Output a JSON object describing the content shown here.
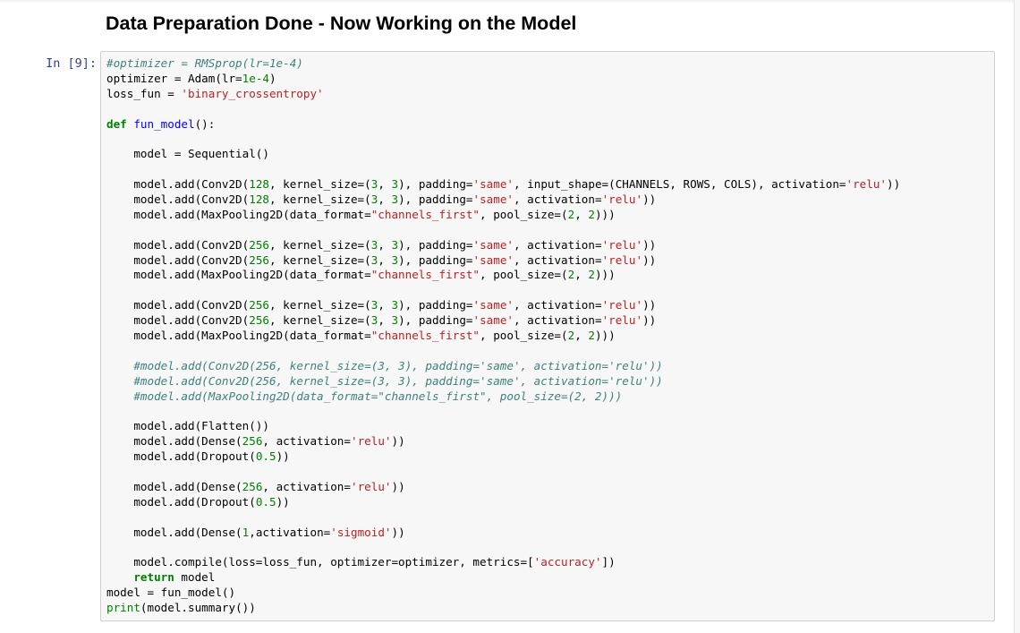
{
  "heading": "Data Preparation Done - Now Working on the Model",
  "cell": {
    "prompt": "In [9]:",
    "lines": [
      [
        {
          "t": "cm",
          "v": "#optimizer = RMSprop(lr=1e-4)"
        }
      ],
      [
        {
          "t": "tx",
          "v": "optimizer = Adam(lr="
        },
        {
          "t": "nm",
          "v": "1e-4"
        },
        {
          "t": "tx",
          "v": ")"
        }
      ],
      [
        {
          "t": "tx",
          "v": "loss_fun = "
        },
        {
          "t": "st",
          "v": "'binary_crossentropy'"
        }
      ],
      [],
      [
        {
          "t": "kw",
          "v": "def"
        },
        {
          "t": "tx",
          "v": " "
        },
        {
          "t": "fn",
          "v": "fun_model"
        },
        {
          "t": "tx",
          "v": "():"
        }
      ],
      [],
      [
        {
          "t": "tx",
          "v": "    model = Sequential()"
        }
      ],
      [],
      [
        {
          "t": "tx",
          "v": "    model.add(Conv2D("
        },
        {
          "t": "nm",
          "v": "128"
        },
        {
          "t": "tx",
          "v": ", kernel_size=("
        },
        {
          "t": "nm",
          "v": "3"
        },
        {
          "t": "tx",
          "v": ", "
        },
        {
          "t": "nm",
          "v": "3"
        },
        {
          "t": "tx",
          "v": "), padding="
        },
        {
          "t": "st",
          "v": "'same'"
        },
        {
          "t": "tx",
          "v": ", input_shape=(CHANNELS, ROWS, COLS), activation="
        },
        {
          "t": "st",
          "v": "'relu'"
        },
        {
          "t": "tx",
          "v": "))"
        }
      ],
      [
        {
          "t": "tx",
          "v": "    model.add(Conv2D("
        },
        {
          "t": "nm",
          "v": "128"
        },
        {
          "t": "tx",
          "v": ", kernel_size=("
        },
        {
          "t": "nm",
          "v": "3"
        },
        {
          "t": "tx",
          "v": ", "
        },
        {
          "t": "nm",
          "v": "3"
        },
        {
          "t": "tx",
          "v": "), padding="
        },
        {
          "t": "st",
          "v": "'same'"
        },
        {
          "t": "tx",
          "v": ", activation="
        },
        {
          "t": "st",
          "v": "'relu'"
        },
        {
          "t": "tx",
          "v": "))"
        }
      ],
      [
        {
          "t": "tx",
          "v": "    model.add(MaxPooling2D(data_format="
        },
        {
          "t": "st",
          "v": "\"channels_first\""
        },
        {
          "t": "tx",
          "v": ", pool_size=("
        },
        {
          "t": "nm",
          "v": "2"
        },
        {
          "t": "tx",
          "v": ", "
        },
        {
          "t": "nm",
          "v": "2"
        },
        {
          "t": "tx",
          "v": ")))"
        }
      ],
      [],
      [
        {
          "t": "tx",
          "v": "    model.add(Conv2D("
        },
        {
          "t": "nm",
          "v": "256"
        },
        {
          "t": "tx",
          "v": ", kernel_size=("
        },
        {
          "t": "nm",
          "v": "3"
        },
        {
          "t": "tx",
          "v": ", "
        },
        {
          "t": "nm",
          "v": "3"
        },
        {
          "t": "tx",
          "v": "), padding="
        },
        {
          "t": "st",
          "v": "'same'"
        },
        {
          "t": "tx",
          "v": ", activation="
        },
        {
          "t": "st",
          "v": "'relu'"
        },
        {
          "t": "tx",
          "v": "))"
        }
      ],
      [
        {
          "t": "tx",
          "v": "    model.add(Conv2D("
        },
        {
          "t": "nm",
          "v": "256"
        },
        {
          "t": "tx",
          "v": ", kernel_size=("
        },
        {
          "t": "nm",
          "v": "3"
        },
        {
          "t": "tx",
          "v": ", "
        },
        {
          "t": "nm",
          "v": "3"
        },
        {
          "t": "tx",
          "v": "), padding="
        },
        {
          "t": "st",
          "v": "'same'"
        },
        {
          "t": "tx",
          "v": ", activation="
        },
        {
          "t": "st",
          "v": "'relu'"
        },
        {
          "t": "tx",
          "v": "))"
        }
      ],
      [
        {
          "t": "tx",
          "v": "    model.add(MaxPooling2D(data_format="
        },
        {
          "t": "st",
          "v": "\"channels_first\""
        },
        {
          "t": "tx",
          "v": ", pool_size=("
        },
        {
          "t": "nm",
          "v": "2"
        },
        {
          "t": "tx",
          "v": ", "
        },
        {
          "t": "nm",
          "v": "2"
        },
        {
          "t": "tx",
          "v": ")))"
        }
      ],
      [],
      [
        {
          "t": "tx",
          "v": "    model.add(Conv2D("
        },
        {
          "t": "nm",
          "v": "256"
        },
        {
          "t": "tx",
          "v": ", kernel_size=("
        },
        {
          "t": "nm",
          "v": "3"
        },
        {
          "t": "tx",
          "v": ", "
        },
        {
          "t": "nm",
          "v": "3"
        },
        {
          "t": "tx",
          "v": "), padding="
        },
        {
          "t": "st",
          "v": "'same'"
        },
        {
          "t": "tx",
          "v": ", activation="
        },
        {
          "t": "st",
          "v": "'relu'"
        },
        {
          "t": "tx",
          "v": "))"
        }
      ],
      [
        {
          "t": "tx",
          "v": "    model.add(Conv2D("
        },
        {
          "t": "nm",
          "v": "256"
        },
        {
          "t": "tx",
          "v": ", kernel_size=("
        },
        {
          "t": "nm",
          "v": "3"
        },
        {
          "t": "tx",
          "v": ", "
        },
        {
          "t": "nm",
          "v": "3"
        },
        {
          "t": "tx",
          "v": "), padding="
        },
        {
          "t": "st",
          "v": "'same'"
        },
        {
          "t": "tx",
          "v": ", activation="
        },
        {
          "t": "st",
          "v": "'relu'"
        },
        {
          "t": "tx",
          "v": "))"
        }
      ],
      [
        {
          "t": "tx",
          "v": "    model.add(MaxPooling2D(data_format="
        },
        {
          "t": "st",
          "v": "\"channels_first\""
        },
        {
          "t": "tx",
          "v": ", pool_size=("
        },
        {
          "t": "nm",
          "v": "2"
        },
        {
          "t": "tx",
          "v": ", "
        },
        {
          "t": "nm",
          "v": "2"
        },
        {
          "t": "tx",
          "v": ")))"
        }
      ],
      [],
      [
        {
          "t": "tx",
          "v": "    "
        },
        {
          "t": "cm",
          "v": "#model.add(Conv2D(256, kernel_size=(3, 3), padding='same', activation='relu'))"
        }
      ],
      [
        {
          "t": "tx",
          "v": "    "
        },
        {
          "t": "cm",
          "v": "#model.add(Conv2D(256, kernel_size=(3, 3), padding='same', activation='relu'))"
        }
      ],
      [
        {
          "t": "tx",
          "v": "    "
        },
        {
          "t": "cm",
          "v": "#model.add(MaxPooling2D(data_format=\"channels_first\", pool_size=(2, 2)))"
        }
      ],
      [],
      [
        {
          "t": "tx",
          "v": "    model.add(Flatten())"
        }
      ],
      [
        {
          "t": "tx",
          "v": "    model.add(Dense("
        },
        {
          "t": "nm",
          "v": "256"
        },
        {
          "t": "tx",
          "v": ", activation="
        },
        {
          "t": "st",
          "v": "'relu'"
        },
        {
          "t": "tx",
          "v": "))"
        }
      ],
      [
        {
          "t": "tx",
          "v": "    model.add(Dropout("
        },
        {
          "t": "nm",
          "v": "0.5"
        },
        {
          "t": "tx",
          "v": "))"
        }
      ],
      [],
      [
        {
          "t": "tx",
          "v": "    model.add(Dense("
        },
        {
          "t": "nm",
          "v": "256"
        },
        {
          "t": "tx",
          "v": ", activation="
        },
        {
          "t": "st",
          "v": "'relu'"
        },
        {
          "t": "tx",
          "v": "))"
        }
      ],
      [
        {
          "t": "tx",
          "v": "    model.add(Dropout("
        },
        {
          "t": "nm",
          "v": "0.5"
        },
        {
          "t": "tx",
          "v": "))"
        }
      ],
      [],
      [
        {
          "t": "tx",
          "v": "    model.add(Dense("
        },
        {
          "t": "nm",
          "v": "1"
        },
        {
          "t": "tx",
          "v": ",activation="
        },
        {
          "t": "st",
          "v": "'sigmoid'"
        },
        {
          "t": "tx",
          "v": "))"
        }
      ],
      [],
      [
        {
          "t": "tx",
          "v": "    model.compile(loss=loss_fun, optimizer=optimizer, metrics=["
        },
        {
          "t": "st",
          "v": "'accuracy'"
        },
        {
          "t": "tx",
          "v": "])"
        }
      ],
      [
        {
          "t": "tx",
          "v": "    "
        },
        {
          "t": "kw",
          "v": "return"
        },
        {
          "t": "tx",
          "v": " model"
        }
      ],
      [
        {
          "t": "tx",
          "v": "model = fun_model()"
        }
      ],
      [
        {
          "t": "bi",
          "v": "print"
        },
        {
          "t": "tx",
          "v": "(model.summary())"
        }
      ]
    ]
  },
  "colors": {
    "prompt": "#303f9f",
    "comment": "#408080",
    "keyword": "#008000",
    "string": "#ba2121",
    "number": "#008000",
    "function": "#0000ff",
    "cell_background": "#f7f7f7",
    "cell_border": "#cfcfcf"
  }
}
